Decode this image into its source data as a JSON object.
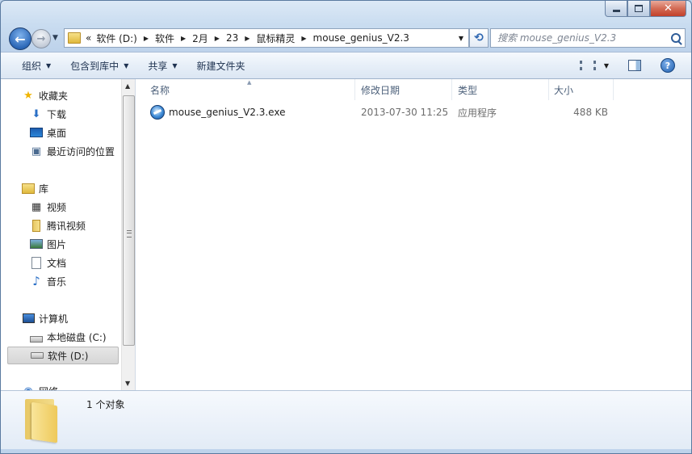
{
  "window": {
    "close_glyph": "✕"
  },
  "nav": {
    "back_glyph": "←",
    "forward_glyph": "→",
    "overflow": "«",
    "breadcrumb": [
      "软件 (D:)",
      "软件",
      "2月",
      "23",
      "鼠标精灵",
      "mouse_genius_V2.3"
    ],
    "search_placeholder": "搜索 mouse_genius_V2.3"
  },
  "toolbar": {
    "organize": "组织",
    "include_in_library": "包含到库中",
    "share": "共享",
    "new_folder": "新建文件夹"
  },
  "sidebar": {
    "favorites": "收藏夹",
    "downloads": "下载",
    "desktop": "桌面",
    "recent": "最近访问的位置",
    "libraries": "库",
    "videos": "视频",
    "tencent_video": "腾讯视频",
    "pictures": "图片",
    "documents": "文档",
    "music": "音乐",
    "computer": "计算机",
    "local_disk_c": "本地磁盘 (C:)",
    "software_d": "软件 (D:)",
    "network": "网络"
  },
  "columns": {
    "name": "名称",
    "modified": "修改日期",
    "type": "类型",
    "size": "大小"
  },
  "files": [
    {
      "name": "mouse_genius_V2.3.exe",
      "modified": "2013-07-30 11:25",
      "type": "应用程序",
      "size": "488 KB"
    }
  ],
  "details": {
    "count": "1 个对象"
  },
  "colors": {
    "window_frame": "#bed3eb",
    "selection": "#d6d6d6",
    "close_button": "#c2402a"
  }
}
